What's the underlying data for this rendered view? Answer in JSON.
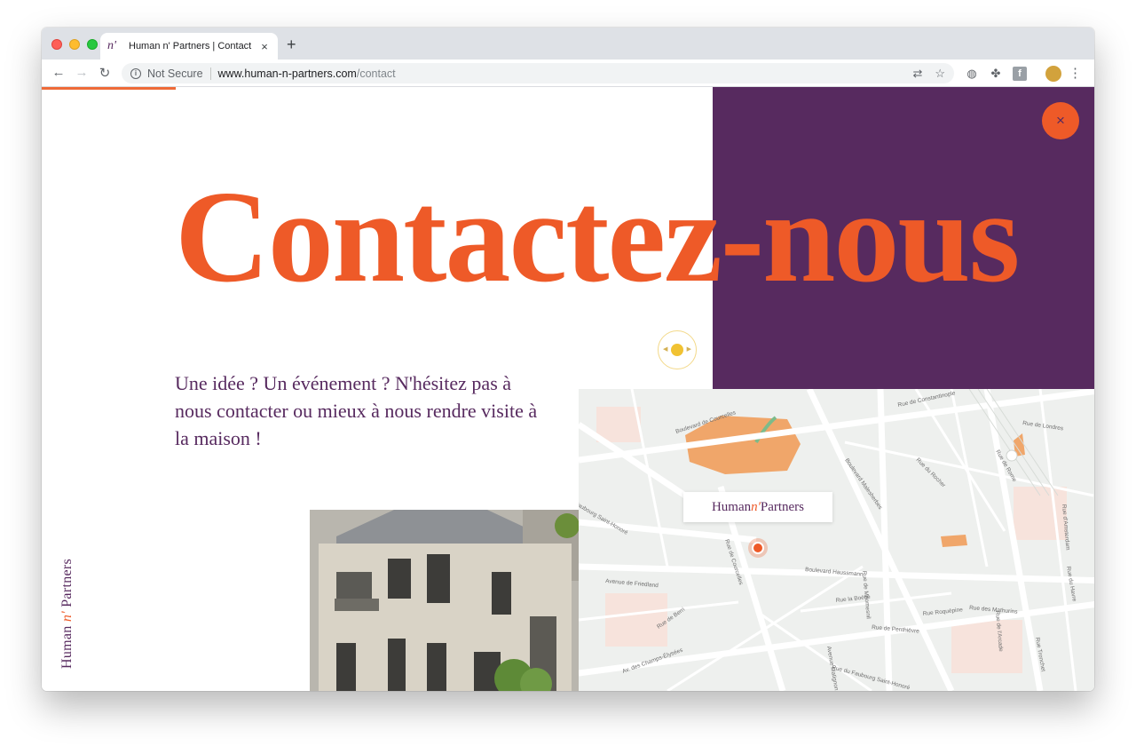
{
  "browser": {
    "tab_title": "Human n' Partners | Contact",
    "tab_favicon": "n'",
    "new_tab": "+",
    "security_label": "Not Secure",
    "url_host": "www.human-n-partners.com",
    "url_path": "/contact"
  },
  "page": {
    "close_symbol": "×",
    "headline": "Contactez-nous",
    "lead": "Une idée ? Un événement ? N'hésitez pas à nous contacter ou mieux à nous rendre visite à la maison !",
    "side_logo": {
      "part1": "Human ",
      "accent": "n'",
      "part2": " Partners"
    },
    "map": {
      "label": {
        "part1": "Human ",
        "accent": "n'",
        "part2": " Partners"
      },
      "streets": [
        "Boulevard de Courcelles",
        "Rue de Constantinople",
        "Rue de Londres",
        "Rue de Rome",
        "Rue du Rocher",
        "Boulevard Malesherbes",
        "Faubourg Saint-Honoré",
        "Avenue de Friedland",
        "Rue de Courcelles",
        "Boulevard Haussmann",
        "Rue de Miromesnil",
        "Rue la Boétie",
        "Rue de Berri",
        "Rue de Penthièvre",
        "Rue Roquépine",
        "Rue des Mathurins",
        "Av. des Champs-Élysées",
        "Avenue Matignon",
        "Rue du Faubourg Saint-Honoré",
        "Rue de l'Arcade",
        "Rue Tronchet",
        "Rue du Havre",
        "Rue d'Amsterdam"
      ]
    }
  },
  "colors": {
    "brand_orange": "#ee5a28",
    "brand_purple": "#572a5f",
    "accent_yellow": "#f1c232",
    "park_orange": "#f0a66a"
  },
  "icons": [
    "back-arrow-icon",
    "forward-arrow-icon",
    "reload-icon",
    "info-icon",
    "translate-icon",
    "star-icon",
    "globe-icon",
    "extension-icon",
    "facebook-icon",
    "avatar",
    "menu-icon",
    "close-icon"
  ]
}
